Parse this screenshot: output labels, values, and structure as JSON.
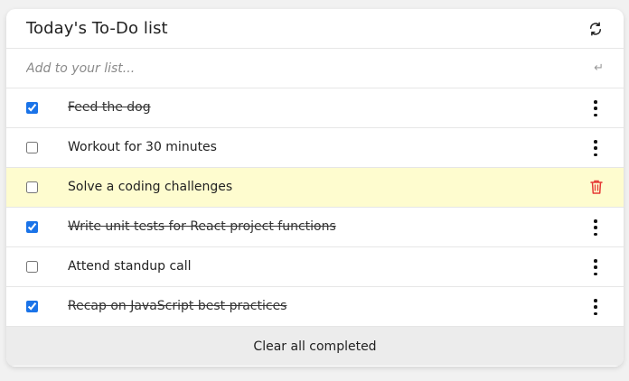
{
  "card": {
    "title": "Today's To-Do list",
    "add_placeholder": "Add to your list...",
    "enter_icon_glyph": "↵",
    "footer_label": "Clear all completed"
  },
  "items": [
    {
      "text": "Feed the dog",
      "done": true,
      "action": "menu"
    },
    {
      "text": "Workout for 30 minutes",
      "done": false,
      "action": "menu"
    },
    {
      "text": "Solve a coding challenges",
      "done": false,
      "action": "delete",
      "highlighted": true
    },
    {
      "text": "Write unit tests for React project functions",
      "done": true,
      "action": "menu"
    },
    {
      "text": "Attend standup call",
      "done": false,
      "action": "menu"
    },
    {
      "text": "Recap on JavaScript best practices",
      "done": true,
      "action": "menu"
    }
  ],
  "colors": {
    "highlight": "#fefccf",
    "trash": "#e53935",
    "checkbox": "#1a73e8"
  },
  "icons": {
    "refresh": "refresh-icon",
    "enter": "enter-icon",
    "menu": "more-vertical-icon",
    "delete": "trash-icon"
  }
}
